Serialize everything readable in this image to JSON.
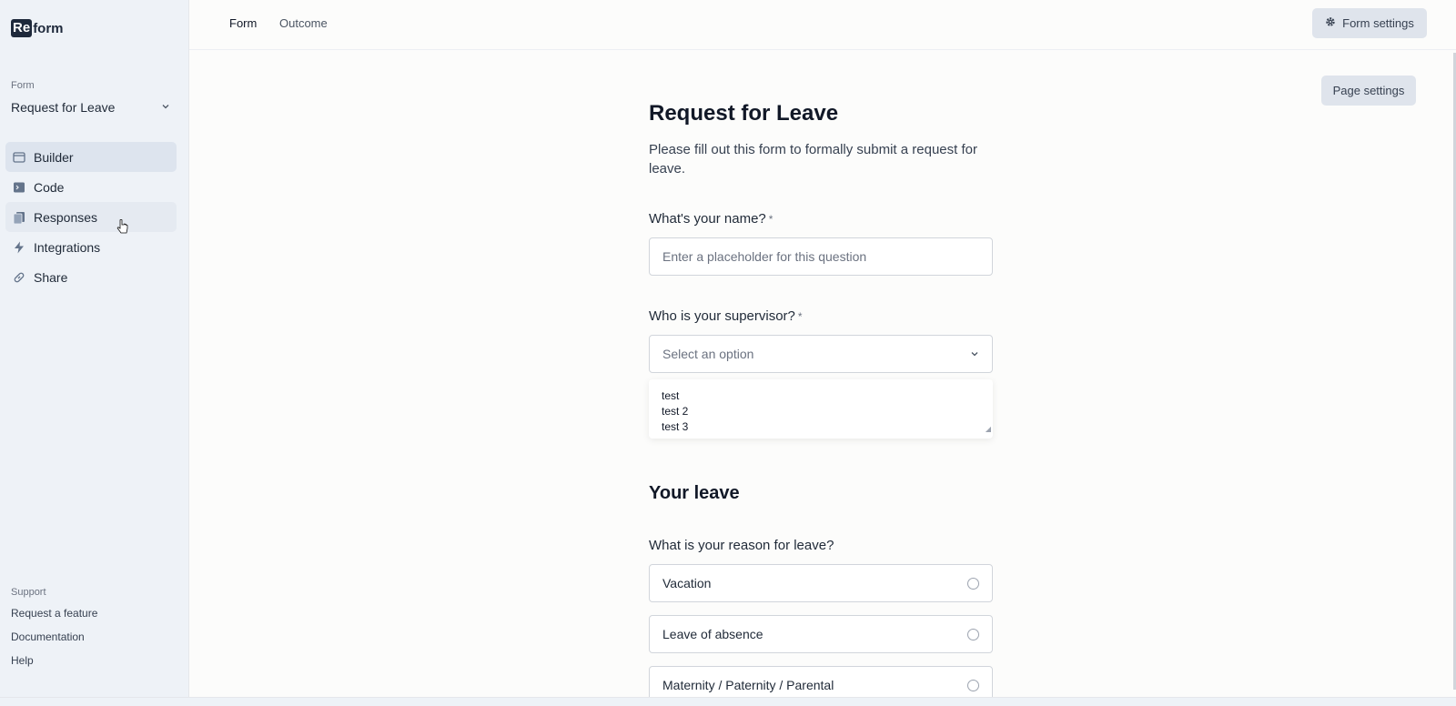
{
  "app": {
    "logo_prefix": "Re",
    "logo_suffix": "form"
  },
  "sidebar": {
    "form_section_label": "Form",
    "form_name": "Request for Leave",
    "items": [
      {
        "label": "Builder",
        "icon": "browser-window-icon"
      },
      {
        "label": "Code",
        "icon": "terminal-icon"
      },
      {
        "label": "Responses",
        "icon": "documents-icon"
      },
      {
        "label": "Integrations",
        "icon": "lightning-icon"
      },
      {
        "label": "Share",
        "icon": "link-icon"
      }
    ],
    "support_label": "Support",
    "support_links": [
      "Request a feature",
      "Documentation",
      "Help"
    ]
  },
  "topbar": {
    "tabs": [
      "Form",
      "Outcome"
    ],
    "form_settings_label": "Form settings"
  },
  "page_settings_label": "Page settings",
  "form": {
    "title": "Request for Leave",
    "description": "Please fill out this form to formally submit a request for leave.",
    "q1": {
      "label": "What's your name?",
      "required_mark": "*",
      "placeholder": "Enter a placeholder for this question"
    },
    "q2": {
      "label": "Who is your supervisor?",
      "required_mark": "*",
      "placeholder": "Select an option",
      "options": [
        "test",
        "test 2",
        "test 3"
      ]
    },
    "section_title": "Your leave",
    "q3": {
      "label": "What is your reason for leave?",
      "options": [
        "Vacation",
        "Leave of absence",
        "Maternity / Paternity / Parental"
      ]
    }
  }
}
